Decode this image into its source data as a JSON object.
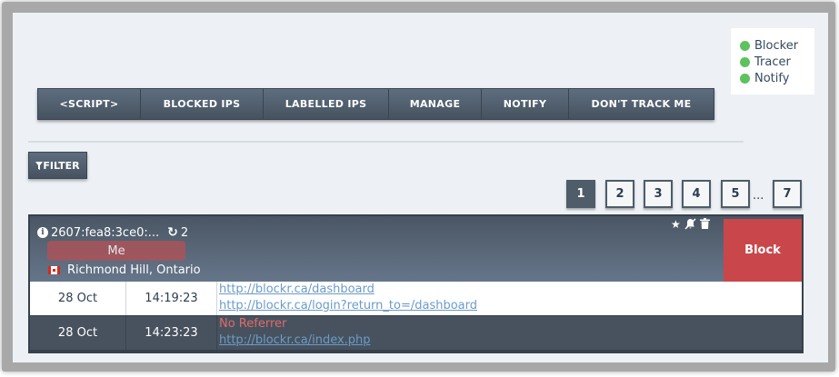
{
  "status": {
    "items": [
      {
        "label": "Blocker",
        "color": "#5ec25e"
      },
      {
        "label": "Tracer",
        "color": "#5ec25e"
      },
      {
        "label": "Notify",
        "color": "#5ec25e"
      }
    ]
  },
  "nav": {
    "items": [
      "<SCRIPT>",
      "BLOCKED IPS",
      "LABELLED IPS",
      "MANAGE",
      "NOTIFY",
      "DON'T TRACK ME"
    ]
  },
  "filter": {
    "label": "FILTER",
    "icon": "filter-icon"
  },
  "pagination": {
    "pages": [
      "1",
      "2",
      "3",
      "4",
      "5",
      "7"
    ],
    "active": "1",
    "ellipsis": "..."
  },
  "visitor": {
    "ip": "2607:fea8:3ce0:...",
    "visits": "2",
    "label": "Me",
    "location": "Richmond Hill, Ontario",
    "block_label": "Block",
    "label_color": "#aa5459",
    "block_color": "#c9474b"
  },
  "visits": [
    {
      "date": "28 Oct",
      "time": "14:19:23",
      "links": [
        "http://blockr.ca/dashboard",
        "http://blockr.ca/login?return_to=/dashboard"
      ]
    },
    {
      "date": "28 Oct",
      "time": "14:23:23",
      "referrer": "No Referrer",
      "links": [
        "http://blockr.ca/index.php"
      ]
    }
  ]
}
